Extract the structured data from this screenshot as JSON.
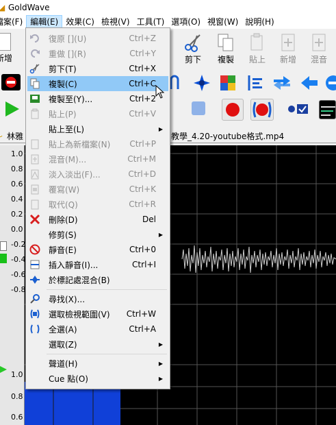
{
  "app": {
    "title": "GoldWave"
  },
  "menubar": {
    "items": [
      {
        "label": "檔案(F)"
      },
      {
        "label": "編輯(E)"
      },
      {
        "label": "效果(C)"
      },
      {
        "label": "檢視(V)"
      },
      {
        "label": "工具(T)"
      },
      {
        "label": "選項(O)"
      },
      {
        "label": "視窗(W)"
      },
      {
        "label": "說明(H)"
      }
    ]
  },
  "toolbar": {
    "new_label": "新增",
    "cut_label": "剪下",
    "copy_label": "複製",
    "paste_label": "貼上",
    "add_label": "新增",
    "mix_label": "混音"
  },
  "document": {
    "title": "教學_4.20-youtube格式.mp4",
    "prefix": "林雅"
  },
  "waveform": {
    "axis_top": [
      "1.0",
      "0.8",
      "0.6",
      "0.4",
      "0.2",
      "0.0",
      "-0.2",
      "-0.4",
      "-0.6",
      "-0.8"
    ],
    "axis_bottom": [
      "1.0",
      "0.8",
      "0.6"
    ]
  },
  "edit_menu": {
    "items": [
      {
        "icon": "undo-icon",
        "label": "復原 [](U)",
        "shortcut": "Ctrl+Z",
        "disabled": true
      },
      {
        "icon": "redo-icon",
        "label": "重做 [](R)",
        "shortcut": "Ctrl+Y",
        "disabled": true
      },
      {
        "icon": "scissors-icon",
        "label": "剪下(T)",
        "shortcut": "Ctrl+X",
        "disabled": false
      },
      {
        "icon": "copy-icon",
        "label": "複製(C)",
        "shortcut": "Ctrl+C",
        "disabled": false,
        "highlighted": true
      },
      {
        "icon": "copy-to-icon",
        "label": "複製至(Y)...",
        "shortcut": "Ctrl+2",
        "disabled": false
      },
      {
        "icon": "paste-icon",
        "label": "貼上(P)",
        "shortcut": "Ctrl+V",
        "disabled": true
      },
      {
        "icon": "",
        "label": "貼上至(L)",
        "shortcut": "",
        "disabled": false,
        "submenu": true
      },
      {
        "icon": "paste-new-icon",
        "label": "貼上為新檔案(N)",
        "shortcut": "Ctrl+P",
        "disabled": true
      },
      {
        "icon": "mix-icon",
        "label": "混音(M)...",
        "shortcut": "Ctrl+M",
        "disabled": true
      },
      {
        "icon": "fade-icon",
        "label": "淡入淡出(F)...",
        "shortcut": "Ctrl+D",
        "disabled": true
      },
      {
        "icon": "overlap-icon",
        "label": "覆寫(W)",
        "shortcut": "Ctrl+K",
        "disabled": true
      },
      {
        "icon": "replace-icon",
        "label": "取代(Q)",
        "shortcut": "Ctrl+R",
        "disabled": true
      },
      {
        "icon": "delete-icon",
        "label": "刪除(D)",
        "shortcut": "Del",
        "disabled": false
      },
      {
        "icon": "",
        "label": "修剪(S)",
        "shortcut": "",
        "disabled": false,
        "submenu": true
      },
      {
        "icon": "silence-icon",
        "label": "靜音(E)",
        "shortcut": "Ctrl+0",
        "disabled": false
      },
      {
        "icon": "insert-silence-icon",
        "label": "插入靜音(I)...",
        "shortcut": "Ctrl+I",
        "disabled": false
      },
      {
        "icon": "mix-at-marker-icon",
        "label": "於標記處混合(B)",
        "shortcut": "",
        "disabled": false
      },
      {
        "icon": "find-icon",
        "label": "尋找(X)...",
        "shortcut": "",
        "disabled": false
      },
      {
        "icon": "select-view-icon",
        "label": "選取檢視範圍(V)",
        "shortcut": "Ctrl+W",
        "disabled": false
      },
      {
        "icon": "select-all-icon",
        "label": "全選(A)",
        "shortcut": "Ctrl+A",
        "disabled": false
      },
      {
        "icon": "",
        "label": "選取(Z)",
        "shortcut": "",
        "disabled": false,
        "submenu": true
      },
      {
        "icon": "",
        "label": "聲道(H)",
        "shortcut": "",
        "disabled": false,
        "submenu": true
      },
      {
        "icon": "",
        "label": "Cue 點(O)",
        "shortcut": "",
        "disabled": false,
        "submenu": true
      }
    ]
  },
  "colors": {
    "highlight": "#91c9f7",
    "accent_blue": "#0a4fd6",
    "wave_green": "#2ec22e"
  }
}
